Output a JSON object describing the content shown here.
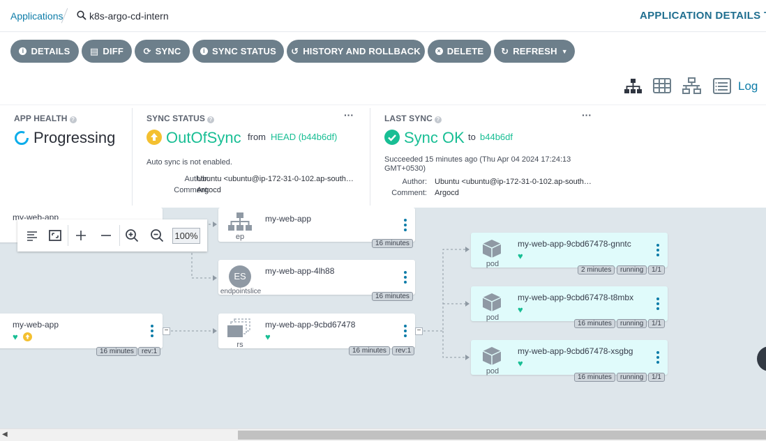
{
  "breadcrumb": {
    "root": "Applications",
    "app": "k8s-argo-cd-intern"
  },
  "page_title": "APPLICATION DETAILS TREE",
  "toolbar": {
    "details": "DETAILS",
    "diff": "DIFF",
    "sync": "SYNC",
    "sync_status": "SYNC STATUS",
    "history": "HISTORY AND ROLLBACK",
    "delete": "DELETE",
    "refresh": "REFRESH"
  },
  "view_icons": [
    "tree-view-icon",
    "pods-view-icon",
    "network-view-icon",
    "list-view-icon"
  ],
  "logs_link": "Log",
  "app_health": {
    "label": "APP HEALTH",
    "value": "Progressing",
    "color": "#0dadea"
  },
  "sync_status": {
    "label": "SYNC STATUS",
    "value": "OutOfSync",
    "from_label": "from",
    "revision": "HEAD (b44b6df)",
    "auto_sync": "Auto sync is not enabled.",
    "author_label": "Author:",
    "author": "Ubuntu <ubuntu@ip-172-31-0-102.ap-south…",
    "comment_label": "Comment:",
    "comment": "Argocd",
    "color": "#f4c030"
  },
  "last_sync": {
    "label": "LAST SYNC",
    "value": "Sync OK",
    "to_label": "to",
    "revision": "b44b6df",
    "succeeded": "Succeeded 15 minutes ago (Thu Apr 04 2024 17:24:13",
    "tz": "GMT+0530)",
    "author_label": "Author:",
    "author": "Ubuntu <ubuntu@ip-172-31-0-102.ap-south…",
    "comment_label": "Comment:",
    "comment": "Argocd",
    "color": "#18be94"
  },
  "zoom": {
    "level": "100%"
  },
  "nodes": {
    "svc": {
      "name": "my-web-app"
    },
    "ep": {
      "name": "my-web-app",
      "kind": "ep",
      "age": "16 minutes"
    },
    "es": {
      "name": "my-web-app-4lh88",
      "kind": "endpointslice",
      "badge": "ES",
      "age": "16 minutes"
    },
    "deploy": {
      "name": "my-web-app",
      "age": "16 minutes",
      "rev": "rev:1"
    },
    "rs": {
      "name": "my-web-app-9cbd67478",
      "kind": "rs",
      "age": "16 minutes",
      "rev": "rev:1"
    },
    "pods": [
      {
        "name": "my-web-app-9cbd67478-gnntc",
        "kind": "pod",
        "age": "2 minutes",
        "status": "running",
        "ready": "1/1"
      },
      {
        "name": "my-web-app-9cbd67478-t8mbx",
        "kind": "pod",
        "age": "16 minutes",
        "status": "running",
        "ready": "1/1"
      },
      {
        "name": "my-web-app-9cbd67478-xsgbg",
        "kind": "pod",
        "age": "16 minutes",
        "status": "running",
        "ready": "1/1"
      }
    ]
  }
}
